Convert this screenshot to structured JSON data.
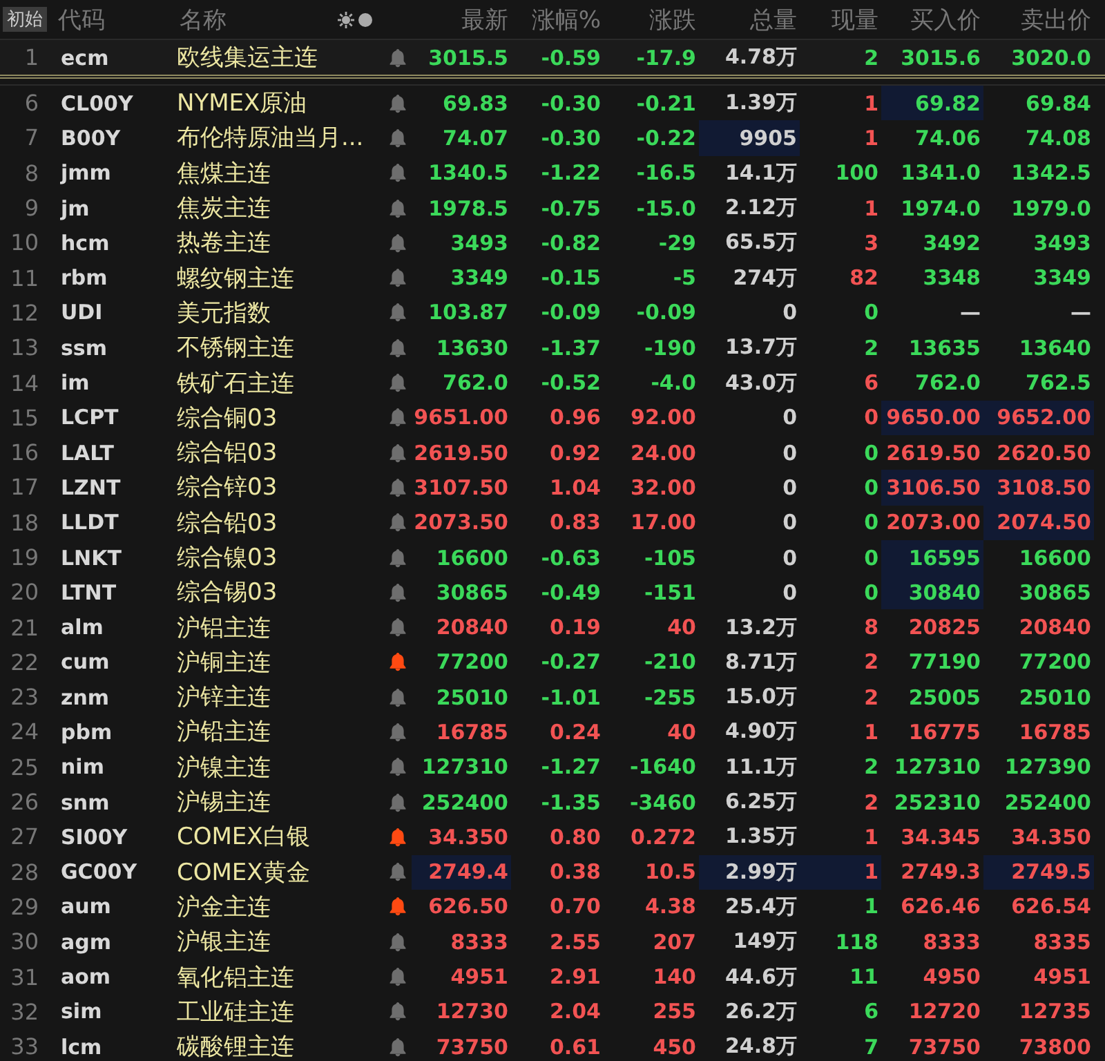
{
  "header": {
    "preset": {
      "label": "初始",
      "selected": true
    },
    "columns": [
      "代码",
      "名称",
      "最新",
      "涨幅%",
      "涨跌",
      "总量",
      "现量",
      "买入价",
      "卖出价"
    ]
  },
  "pinned_rows": [
    {
      "no": "1",
      "code": "ecm",
      "name": "欧线集运主连",
      "alert": false,
      "cells": [
        {
          "t": "3015.5",
          "color": "#3bd95a",
          "hl": false
        },
        {
          "t": "-0.59",
          "color": "#3bd95a",
          "hl": false
        },
        {
          "t": "-17.9",
          "color": "#3bd95a",
          "hl": false
        },
        {
          "t": "4.78万",
          "color": "#d0d0d0",
          "hl": false
        },
        {
          "t": "2",
          "color": "#3bd95a",
          "hl": false
        },
        {
          "t": "3015.6",
          "color": "#3bd95a",
          "hl": false
        },
        {
          "t": "3020.0",
          "color": "#3bd95a",
          "hl": false
        }
      ]
    }
  ],
  "rows": [
    {
      "no": "6",
      "code": "CL00Y",
      "name": "NYMEX原油",
      "alert": false,
      "cells": [
        {
          "t": "69.83",
          "color": "#3bd95a",
          "hl": false
        },
        {
          "t": "-0.30",
          "color": "#3bd95a",
          "hl": false
        },
        {
          "t": "-0.21",
          "color": "#3bd95a",
          "hl": false
        },
        {
          "t": "1.39万",
          "color": "#d0d0d0",
          "hl": false
        },
        {
          "t": "1",
          "color": "#f25353",
          "hl": false
        },
        {
          "t": "69.82",
          "color": "#3bd95a",
          "hl": true
        },
        {
          "t": "69.84",
          "color": "#3bd95a",
          "hl": false
        }
      ]
    },
    {
      "no": "7",
      "code": "B00Y",
      "name": "布伦特原油当月...",
      "alert": false,
      "cells": [
        {
          "t": "74.07",
          "color": "#3bd95a",
          "hl": false
        },
        {
          "t": "-0.30",
          "color": "#3bd95a",
          "hl": false
        },
        {
          "t": "-0.22",
          "color": "#3bd95a",
          "hl": false
        },
        {
          "t": "9905",
          "color": "#d0d0d0",
          "hl": true
        },
        {
          "t": "1",
          "color": "#f25353",
          "hl": false
        },
        {
          "t": "74.06",
          "color": "#3bd95a",
          "hl": false
        },
        {
          "t": "74.08",
          "color": "#3bd95a",
          "hl": false
        }
      ]
    },
    {
      "no": "8",
      "code": "jmm",
      "name": "焦煤主连",
      "alert": false,
      "cells": [
        {
          "t": "1340.5",
          "color": "#3bd95a",
          "hl": false
        },
        {
          "t": "-1.22",
          "color": "#3bd95a",
          "hl": false
        },
        {
          "t": "-16.5",
          "color": "#3bd95a",
          "hl": false
        },
        {
          "t": "14.1万",
          "color": "#d0d0d0",
          "hl": false
        },
        {
          "t": "100",
          "color": "#3bd95a",
          "hl": false
        },
        {
          "t": "1341.0",
          "color": "#3bd95a",
          "hl": false
        },
        {
          "t": "1342.5",
          "color": "#3bd95a",
          "hl": false
        }
      ]
    },
    {
      "no": "9",
      "code": "jm",
      "name": "焦炭主连",
      "alert": false,
      "cells": [
        {
          "t": "1978.5",
          "color": "#3bd95a",
          "hl": false
        },
        {
          "t": "-0.75",
          "color": "#3bd95a",
          "hl": false
        },
        {
          "t": "-15.0",
          "color": "#3bd95a",
          "hl": false
        },
        {
          "t": "2.12万",
          "color": "#d0d0d0",
          "hl": false
        },
        {
          "t": "1",
          "color": "#f25353",
          "hl": false
        },
        {
          "t": "1974.0",
          "color": "#3bd95a",
          "hl": false
        },
        {
          "t": "1979.0",
          "color": "#3bd95a",
          "hl": false
        }
      ]
    },
    {
      "no": "10",
      "code": "hcm",
      "name": "热卷主连",
      "alert": false,
      "cells": [
        {
          "t": "3493",
          "color": "#3bd95a",
          "hl": false
        },
        {
          "t": "-0.82",
          "color": "#3bd95a",
          "hl": false
        },
        {
          "t": "-29",
          "color": "#3bd95a",
          "hl": false
        },
        {
          "t": "65.5万",
          "color": "#d0d0d0",
          "hl": false
        },
        {
          "t": "3",
          "color": "#f25353",
          "hl": false
        },
        {
          "t": "3492",
          "color": "#3bd95a",
          "hl": false
        },
        {
          "t": "3493",
          "color": "#3bd95a",
          "hl": false
        }
      ]
    },
    {
      "no": "11",
      "code": "rbm",
      "name": "螺纹钢主连",
      "alert": false,
      "cells": [
        {
          "t": "3349",
          "color": "#3bd95a",
          "hl": false
        },
        {
          "t": "-0.15",
          "color": "#3bd95a",
          "hl": false
        },
        {
          "t": "-5",
          "color": "#3bd95a",
          "hl": false
        },
        {
          "t": "274万",
          "color": "#d0d0d0",
          "hl": false
        },
        {
          "t": "82",
          "color": "#f25353",
          "hl": false
        },
        {
          "t": "3348",
          "color": "#3bd95a",
          "hl": false
        },
        {
          "t": "3349",
          "color": "#3bd95a",
          "hl": false
        }
      ]
    },
    {
      "no": "12",
      "code": "UDI",
      "name": "美元指数",
      "alert": false,
      "cells": [
        {
          "t": "103.87",
          "color": "#3bd95a",
          "hl": false
        },
        {
          "t": "-0.09",
          "color": "#3bd95a",
          "hl": false
        },
        {
          "t": "-0.09",
          "color": "#3bd95a",
          "hl": false
        },
        {
          "t": "0",
          "color": "#d0d0d0",
          "hl": false
        },
        {
          "t": "0",
          "color": "#3bd95a",
          "hl": false
        },
        {
          "t": "—",
          "color": "#d0d0d0",
          "hl": false
        },
        {
          "t": "—",
          "color": "#d0d0d0",
          "hl": false
        }
      ]
    },
    {
      "no": "13",
      "code": "ssm",
      "name": "不锈钢主连",
      "alert": false,
      "cells": [
        {
          "t": "13630",
          "color": "#3bd95a",
          "hl": false
        },
        {
          "t": "-1.37",
          "color": "#3bd95a",
          "hl": false
        },
        {
          "t": "-190",
          "color": "#3bd95a",
          "hl": false
        },
        {
          "t": "13.7万",
          "color": "#d0d0d0",
          "hl": false
        },
        {
          "t": "2",
          "color": "#3bd95a",
          "hl": false
        },
        {
          "t": "13635",
          "color": "#3bd95a",
          "hl": false
        },
        {
          "t": "13640",
          "color": "#3bd95a",
          "hl": false
        }
      ]
    },
    {
      "no": "14",
      "code": "im",
      "name": "铁矿石主连",
      "alert": false,
      "cells": [
        {
          "t": "762.0",
          "color": "#3bd95a",
          "hl": false
        },
        {
          "t": "-0.52",
          "color": "#3bd95a",
          "hl": false
        },
        {
          "t": "-4.0",
          "color": "#3bd95a",
          "hl": false
        },
        {
          "t": "43.0万",
          "color": "#d0d0d0",
          "hl": false
        },
        {
          "t": "6",
          "color": "#f25353",
          "hl": false
        },
        {
          "t": "762.0",
          "color": "#3bd95a",
          "hl": false
        },
        {
          "t": "762.5",
          "color": "#3bd95a",
          "hl": false
        }
      ]
    },
    {
      "no": "15",
      "code": "LCPT",
      "name": "综合铜03",
      "alert": false,
      "cells": [
        {
          "t": "9651.00",
          "color": "#f25353",
          "hl": false
        },
        {
          "t": "0.96",
          "color": "#f25353",
          "hl": false
        },
        {
          "t": "92.00",
          "color": "#f25353",
          "hl": false
        },
        {
          "t": "0",
          "color": "#d0d0d0",
          "hl": false
        },
        {
          "t": "0",
          "color": "#f25353",
          "hl": false
        },
        {
          "t": "9650.00",
          "color": "#f25353",
          "hl": true
        },
        {
          "t": "9652.00",
          "color": "#f25353",
          "hl": true
        }
      ]
    },
    {
      "no": "16",
      "code": "LALT",
      "name": "综合铝03",
      "alert": false,
      "cells": [
        {
          "t": "2619.50",
          "color": "#f25353",
          "hl": false
        },
        {
          "t": "0.92",
          "color": "#f25353",
          "hl": false
        },
        {
          "t": "24.00",
          "color": "#f25353",
          "hl": false
        },
        {
          "t": "0",
          "color": "#d0d0d0",
          "hl": false
        },
        {
          "t": "0",
          "color": "#3bd95a",
          "hl": false
        },
        {
          "t": "2619.50",
          "color": "#f25353",
          "hl": false
        },
        {
          "t": "2620.50",
          "color": "#f25353",
          "hl": false
        }
      ]
    },
    {
      "no": "17",
      "code": "LZNT",
      "name": "综合锌03",
      "alert": false,
      "cells": [
        {
          "t": "3107.50",
          "color": "#f25353",
          "hl": false
        },
        {
          "t": "1.04",
          "color": "#f25353",
          "hl": false
        },
        {
          "t": "32.00",
          "color": "#f25353",
          "hl": false
        },
        {
          "t": "0",
          "color": "#d0d0d0",
          "hl": false
        },
        {
          "t": "0",
          "color": "#3bd95a",
          "hl": false
        },
        {
          "t": "3106.50",
          "color": "#f25353",
          "hl": true
        },
        {
          "t": "3108.50",
          "color": "#f25353",
          "hl": true
        }
      ]
    },
    {
      "no": "18",
      "code": "LLDT",
      "name": "综合铅03",
      "alert": false,
      "cells": [
        {
          "t": "2073.50",
          "color": "#f25353",
          "hl": false
        },
        {
          "t": "0.83",
          "color": "#f25353",
          "hl": false
        },
        {
          "t": "17.00",
          "color": "#f25353",
          "hl": false
        },
        {
          "t": "0",
          "color": "#d0d0d0",
          "hl": false
        },
        {
          "t": "0",
          "color": "#3bd95a",
          "hl": false
        },
        {
          "t": "2073.00",
          "color": "#f25353",
          "hl": false
        },
        {
          "t": "2074.50",
          "color": "#f25353",
          "hl": true
        }
      ]
    },
    {
      "no": "19",
      "code": "LNKT",
      "name": "综合镍03",
      "alert": false,
      "cells": [
        {
          "t": "16600",
          "color": "#3bd95a",
          "hl": false
        },
        {
          "t": "-0.63",
          "color": "#3bd95a",
          "hl": false
        },
        {
          "t": "-105",
          "color": "#3bd95a",
          "hl": false
        },
        {
          "t": "0",
          "color": "#d0d0d0",
          "hl": false
        },
        {
          "t": "0",
          "color": "#3bd95a",
          "hl": false
        },
        {
          "t": "16595",
          "color": "#3bd95a",
          "hl": true
        },
        {
          "t": "16600",
          "color": "#3bd95a",
          "hl": false
        }
      ]
    },
    {
      "no": "20",
      "code": "LTNT",
      "name": "综合锡03",
      "alert": false,
      "cells": [
        {
          "t": "30865",
          "color": "#3bd95a",
          "hl": false
        },
        {
          "t": "-0.49",
          "color": "#3bd95a",
          "hl": false
        },
        {
          "t": "-151",
          "color": "#3bd95a",
          "hl": false
        },
        {
          "t": "0",
          "color": "#d0d0d0",
          "hl": false
        },
        {
          "t": "0",
          "color": "#3bd95a",
          "hl": false
        },
        {
          "t": "30840",
          "color": "#3bd95a",
          "hl": true
        },
        {
          "t": "30865",
          "color": "#3bd95a",
          "hl": false
        }
      ]
    },
    {
      "no": "21",
      "code": "alm",
      "name": "沪铝主连",
      "alert": false,
      "cells": [
        {
          "t": "20840",
          "color": "#f25353",
          "hl": false
        },
        {
          "t": "0.19",
          "color": "#f25353",
          "hl": false
        },
        {
          "t": "40",
          "color": "#f25353",
          "hl": false
        },
        {
          "t": "13.2万",
          "color": "#d0d0d0",
          "hl": false
        },
        {
          "t": "8",
          "color": "#f25353",
          "hl": false
        },
        {
          "t": "20825",
          "color": "#f25353",
          "hl": false
        },
        {
          "t": "20840",
          "color": "#f25353",
          "hl": false
        }
      ]
    },
    {
      "no": "22",
      "code": "cum",
      "name": "沪铜主连",
      "alert": true,
      "cells": [
        {
          "t": "77200",
          "color": "#3bd95a",
          "hl": false
        },
        {
          "t": "-0.27",
          "color": "#3bd95a",
          "hl": false
        },
        {
          "t": "-210",
          "color": "#3bd95a",
          "hl": false
        },
        {
          "t": "8.71万",
          "color": "#d0d0d0",
          "hl": false
        },
        {
          "t": "2",
          "color": "#f25353",
          "hl": false
        },
        {
          "t": "77190",
          "color": "#3bd95a",
          "hl": false
        },
        {
          "t": "77200",
          "color": "#3bd95a",
          "hl": false
        }
      ]
    },
    {
      "no": "23",
      "code": "znm",
      "name": "沪锌主连",
      "alert": false,
      "cells": [
        {
          "t": "25010",
          "color": "#3bd95a",
          "hl": false
        },
        {
          "t": "-1.01",
          "color": "#3bd95a",
          "hl": false
        },
        {
          "t": "-255",
          "color": "#3bd95a",
          "hl": false
        },
        {
          "t": "15.0万",
          "color": "#d0d0d0",
          "hl": false
        },
        {
          "t": "2",
          "color": "#f25353",
          "hl": false
        },
        {
          "t": "25005",
          "color": "#3bd95a",
          "hl": false
        },
        {
          "t": "25010",
          "color": "#3bd95a",
          "hl": false
        }
      ]
    },
    {
      "no": "24",
      "code": "pbm",
      "name": "沪铅主连",
      "alert": false,
      "cells": [
        {
          "t": "16785",
          "color": "#f25353",
          "hl": false
        },
        {
          "t": "0.24",
          "color": "#f25353",
          "hl": false
        },
        {
          "t": "40",
          "color": "#f25353",
          "hl": false
        },
        {
          "t": "4.90万",
          "color": "#d0d0d0",
          "hl": false
        },
        {
          "t": "1",
          "color": "#f25353",
          "hl": false
        },
        {
          "t": "16775",
          "color": "#f25353",
          "hl": false
        },
        {
          "t": "16785",
          "color": "#f25353",
          "hl": false
        }
      ]
    },
    {
      "no": "25",
      "code": "nim",
      "name": "沪镍主连",
      "alert": false,
      "cells": [
        {
          "t": "127310",
          "color": "#3bd95a",
          "hl": false
        },
        {
          "t": "-1.27",
          "color": "#3bd95a",
          "hl": false
        },
        {
          "t": "-1640",
          "color": "#3bd95a",
          "hl": false
        },
        {
          "t": "11.1万",
          "color": "#d0d0d0",
          "hl": false
        },
        {
          "t": "2",
          "color": "#3bd95a",
          "hl": false
        },
        {
          "t": "127310",
          "color": "#3bd95a",
          "hl": false
        },
        {
          "t": "127390",
          "color": "#3bd95a",
          "hl": false
        }
      ]
    },
    {
      "no": "26",
      "code": "snm",
      "name": "沪锡主连",
      "alert": false,
      "cells": [
        {
          "t": "252400",
          "color": "#3bd95a",
          "hl": false
        },
        {
          "t": "-1.35",
          "color": "#3bd95a",
          "hl": false
        },
        {
          "t": "-3460",
          "color": "#3bd95a",
          "hl": false
        },
        {
          "t": "6.25万",
          "color": "#d0d0d0",
          "hl": false
        },
        {
          "t": "2",
          "color": "#f25353",
          "hl": false
        },
        {
          "t": "252310",
          "color": "#3bd95a",
          "hl": false
        },
        {
          "t": "252400",
          "color": "#3bd95a",
          "hl": false
        }
      ]
    },
    {
      "no": "27",
      "code": "SI00Y",
      "name": "COMEX白银",
      "alert": true,
      "cells": [
        {
          "t": "34.350",
          "color": "#f25353",
          "hl": false
        },
        {
          "t": "0.80",
          "color": "#f25353",
          "hl": false
        },
        {
          "t": "0.272",
          "color": "#f25353",
          "hl": false
        },
        {
          "t": "1.35万",
          "color": "#d0d0d0",
          "hl": false
        },
        {
          "t": "1",
          "color": "#f25353",
          "hl": false
        },
        {
          "t": "34.345",
          "color": "#f25353",
          "hl": false
        },
        {
          "t": "34.350",
          "color": "#f25353",
          "hl": false
        }
      ]
    },
    {
      "no": "28",
      "code": "GC00Y",
      "name": "COMEX黄金",
      "alert": false,
      "cells": [
        {
          "t": "2749.4",
          "color": "#f25353",
          "hl": true
        },
        {
          "t": "0.38",
          "color": "#f25353",
          "hl": false
        },
        {
          "t": "10.5",
          "color": "#f25353",
          "hl": false
        },
        {
          "t": "2.99万",
          "color": "#d0d0d0",
          "hl": true
        },
        {
          "t": "1",
          "color": "#f25353",
          "hl": true
        },
        {
          "t": "2749.3",
          "color": "#f25353",
          "hl": false
        },
        {
          "t": "2749.5",
          "color": "#f25353",
          "hl": true
        }
      ]
    },
    {
      "no": "29",
      "code": "aum",
      "name": "沪金主连",
      "alert": true,
      "cells": [
        {
          "t": "626.50",
          "color": "#f25353",
          "hl": false
        },
        {
          "t": "0.70",
          "color": "#f25353",
          "hl": false
        },
        {
          "t": "4.38",
          "color": "#f25353",
          "hl": false
        },
        {
          "t": "25.4万",
          "color": "#d0d0d0",
          "hl": false
        },
        {
          "t": "1",
          "color": "#3bd95a",
          "hl": false
        },
        {
          "t": "626.46",
          "color": "#f25353",
          "hl": false
        },
        {
          "t": "626.54",
          "color": "#f25353",
          "hl": false
        }
      ]
    },
    {
      "no": "30",
      "code": "agm",
      "name": "沪银主连",
      "alert": false,
      "cells": [
        {
          "t": "8333",
          "color": "#f25353",
          "hl": false
        },
        {
          "t": "2.55",
          "color": "#f25353",
          "hl": false
        },
        {
          "t": "207",
          "color": "#f25353",
          "hl": false
        },
        {
          "t": "149万",
          "color": "#d0d0d0",
          "hl": false
        },
        {
          "t": "118",
          "color": "#3bd95a",
          "hl": false
        },
        {
          "t": "8333",
          "color": "#f25353",
          "hl": false
        },
        {
          "t": "8335",
          "color": "#f25353",
          "hl": false
        }
      ]
    },
    {
      "no": "31",
      "code": "aom",
      "name": "氧化铝主连",
      "alert": false,
      "cells": [
        {
          "t": "4951",
          "color": "#f25353",
          "hl": false
        },
        {
          "t": "2.91",
          "color": "#f25353",
          "hl": false
        },
        {
          "t": "140",
          "color": "#f25353",
          "hl": false
        },
        {
          "t": "44.6万",
          "color": "#d0d0d0",
          "hl": false
        },
        {
          "t": "11",
          "color": "#3bd95a",
          "hl": false
        },
        {
          "t": "4950",
          "color": "#f25353",
          "hl": false
        },
        {
          "t": "4951",
          "color": "#f25353",
          "hl": false
        }
      ]
    },
    {
      "no": "32",
      "code": "sim",
      "name": "工业硅主连",
      "alert": false,
      "cells": [
        {
          "t": "12730",
          "color": "#f25353",
          "hl": false
        },
        {
          "t": "2.04",
          "color": "#f25353",
          "hl": false
        },
        {
          "t": "255",
          "color": "#f25353",
          "hl": false
        },
        {
          "t": "26.2万",
          "color": "#d0d0d0",
          "hl": false
        },
        {
          "t": "6",
          "color": "#3bd95a",
          "hl": false
        },
        {
          "t": "12720",
          "color": "#f25353",
          "hl": false
        },
        {
          "t": "12735",
          "color": "#f25353",
          "hl": false
        }
      ]
    },
    {
      "no": "33",
      "code": "lcm",
      "name": "碳酸锂主连",
      "alert": false,
      "cells": [
        {
          "t": "73750",
          "color": "#f25353",
          "hl": false
        },
        {
          "t": "0.61",
          "color": "#f25353",
          "hl": false
        },
        {
          "t": "450",
          "color": "#f25353",
          "hl": false
        },
        {
          "t": "24.8万",
          "color": "#d0d0d0",
          "hl": false
        },
        {
          "t": "7",
          "color": "#3bd95a",
          "hl": false
        },
        {
          "t": "73750",
          "color": "#f25353",
          "hl": false
        },
        {
          "t": "73800",
          "color": "#f25353",
          "hl": false
        }
      ]
    }
  ]
}
